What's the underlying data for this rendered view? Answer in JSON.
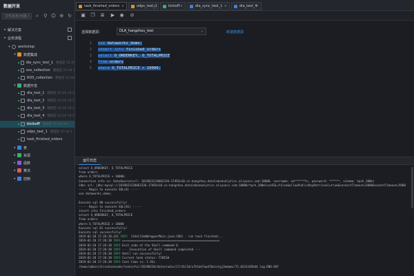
{
  "sidebar": {
    "title": "数据开发",
    "search_placeholder": "文件名称/创建人",
    "rows": [
      {
        "label": "解决方案",
        "kind": "section"
      },
      {
        "label": "业务流程",
        "kind": "section"
      },
      {
        "label": "workshop",
        "kind": "folder"
      },
      {
        "label": "数据集成",
        "kind": "group",
        "color": "#e0902b"
      },
      {
        "label": "dla_sync_test_1",
        "meta": "我锁定 02-20",
        "kind": "node"
      },
      {
        "label": "oss_collection",
        "meta": "我锁定 01-04 1",
        "kind": "node"
      },
      {
        "label": "RDS_collection",
        "meta": "我锁定 01-04",
        "kind": "node"
      },
      {
        "label": "数据开发",
        "kind": "group",
        "color": "#3bb06b"
      },
      {
        "label": "dla_test_1",
        "meta": "我锁定 02-20 10:3",
        "kind": "node"
      },
      {
        "label": "dla_test_2",
        "meta": "我锁定 02-20 10:1",
        "kind": "node"
      },
      {
        "label": "dla_test_3",
        "meta": "我锁定 02-20 10:1",
        "kind": "node"
      },
      {
        "label": "dla_test_4",
        "meta": "我锁定 02-20 10:1",
        "kind": "node"
      },
      {
        "label": "kickoff",
        "meta": "我锁定 01-04 09:1",
        "kind": "node",
        "active": true
      },
      {
        "label": "odps_test_1",
        "meta": "我锁定 01-04 1",
        "kind": "node"
      },
      {
        "label": "task_finished_orders",
        "kind": "node"
      },
      {
        "label": "表",
        "kind": "group",
        "color": "#3d7fe0"
      },
      {
        "label": "资源",
        "kind": "group",
        "color": "#3bb06b"
      },
      {
        "label": "函数",
        "kind": "group",
        "color": "#8a5be0"
      },
      {
        "label": "算法",
        "kind": "group",
        "color": "#e05b5b"
      },
      {
        "label": "控制",
        "kind": "group",
        "color": "#3d7fe0"
      }
    ]
  },
  "tabs": [
    {
      "label": "task_finished_orders",
      "color": "#e0902b",
      "active": true
    },
    {
      "label": "odps_test_1",
      "color": "#e0902b"
    },
    {
      "label": "kickoff",
      "color": "#3bb06b"
    },
    {
      "label": "dla_sync_test_1",
      "color": "#3d7fe0"
    },
    {
      "label": "dla_test_4",
      "color": "#3d7fe0"
    }
  ],
  "datasource": {
    "label": "选择数据源：",
    "value": "DLA_hangzhou_test",
    "new_link": "新建数据源"
  },
  "editor": {
    "lines": [
      {
        "n": "1",
        "text": "use dataworks_demo;"
      },
      {
        "n": "2",
        "text": "insert into finished_orders"
      },
      {
        "n": "3",
        "text": "select O_ORDERKEY, O_TOTALPRICE"
      },
      {
        "n": "4",
        "text": "from orders"
      },
      {
        "n": "5",
        "text": "where O_TOTALPRICE > 10000;"
      }
    ]
  },
  "log": {
    "tab": "运行日志",
    "lines": [
      "select O_ORDERKEY, O_TOTALPRICE",
      "from orders",
      "where O_TOTALPRICE > 10000;",
      "Connection info is: DataSource(url: 1019023128062336-17492e10.cn-hangzhou.datalakeanalytics.aliyuncs.com:10000, username: oa******Yc, password: ******, schema: tpch_100m)",
      "Jdbc url: jdbc:mysql://1019023128062336-17492e10.cn-hangzhou.datalakeanalytics.aliyuncs.com:10000/tpch_100m?useSSL=false&allowPublicKeyRetrieval=true&connectTimeout=5000&socketTimeout=5000",
      "----- Begin to execute SQL(0) -----",
      "use dataworks_demo;",
      "",
      "Execute sql 00 successfully!",
      "----- Begin to execute SQL(01) -----",
      "insert into finished_orders",
      "select O_ORDERKEY, O_TOTALPRICE",
      "from orders",
      "where O_TOTALPRICE > 10000",
      "Execute sql 01 successfully!",
      "Execute sql successfully!",
      "2019-02-20 17:26:38,431 INFO  [ShellCmdWrapperMain.java:190] - run task finished...",
      "2019-02-20 17:26:38 INFO ========================================================",
      "2019-02-20 17:26:38 INFO Exit code of the Shell command 0",
      "2019-02-20 17:26:38 INFO --- Invocation of Shell command completed ---",
      "2019-02-20 17:26:38 INFO Shell run successfully!",
      "2019-02-20 17:26:38 INFO Current task status: FINISH",
      "2019-02-20 17:26:38 INFO Cost time is: 1.93s",
      "/home/admin/alisatasknode/taskinfo//20190220/datastudio/17/26/34/o7h1bk7aw476eivtgj2mdwmv/T3_0331185644.log-END-EOF"
    ]
  }
}
